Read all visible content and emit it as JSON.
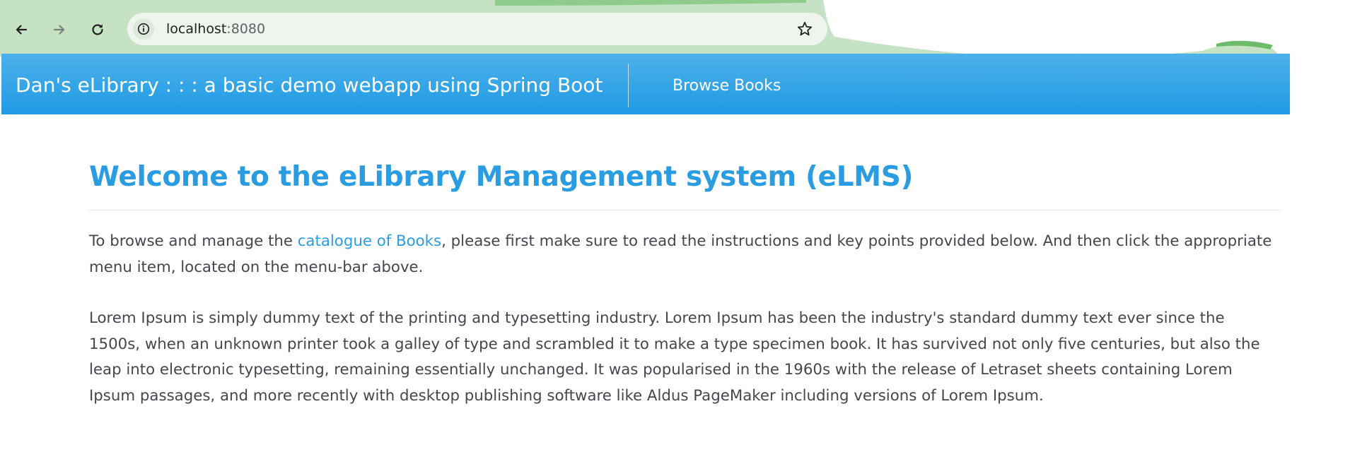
{
  "browser": {
    "url_host": "localhost",
    "url_port": ":8080",
    "icons": {
      "back": "arrow-left-icon",
      "forward": "arrow-right-icon",
      "reload": "reload-icon",
      "site_info": "info-icon",
      "bookmark": "star-icon"
    }
  },
  "navbar": {
    "brand": "Dan's eLibrary : : : a basic demo webapp using Spring Boot",
    "links": [
      {
        "label": "Browse Books"
      }
    ]
  },
  "main": {
    "title": "Welcome to the eLibrary Management system (eLMS)",
    "intro": {
      "before_link": "To browse and manage the ",
      "link_text": "catalogue of Books",
      "after_link": ", please first make sure to read the instructions and key points provided below. And then click the appropriate menu item, located on the menu-bar above."
    },
    "body": "Lorem Ipsum is simply dummy text of the printing and typesetting industry. Lorem Ipsum has been the industry's standard dummy text ever since the 1500s, when an unknown printer took a galley of type and scrambled it to make a type specimen book. It has survived not only five centuries, but also the leap into electronic typesetting, remaining essentially unchanged. It was popularised in the 1960s with the release of Letraset sheets containing Lorem Ipsum passages, and more recently with desktop publishing software like Aldus PageMaker including versions of Lorem Ipsum."
  },
  "colors": {
    "navbar_top": "#4db1ea",
    "navbar_bottom": "#1f9ae4",
    "title": "#2a9de2",
    "link": "#2a9de2",
    "body_text": "#43474d",
    "chrome_green": "#c5e3c4"
  }
}
